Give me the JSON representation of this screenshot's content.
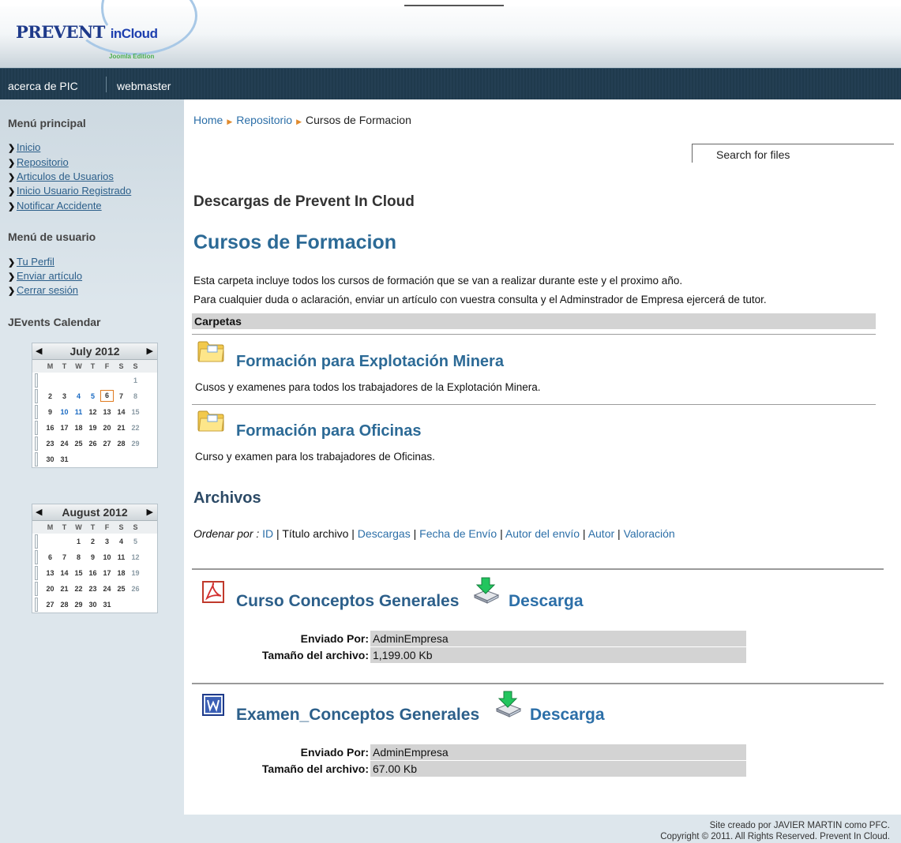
{
  "header": {
    "logo_main": "PREVENT",
    "logo_sub": "inCloud",
    "logo_edition": "Joomla Edition"
  },
  "nav": {
    "items": [
      {
        "label": "acerca de PIC"
      },
      {
        "label": "webmaster"
      }
    ]
  },
  "sidebar": {
    "main_menu_title": "Menú principal",
    "main_menu": [
      {
        "label": "Inicio"
      },
      {
        "label": "Repositorio"
      },
      {
        "label": "Articulos de Usuarios"
      },
      {
        "label": "Inicio Usuario Registrado"
      },
      {
        "label": "Notificar Accidente"
      }
    ],
    "user_menu_title": "Menú de usuario",
    "user_menu": [
      {
        "label": "Tu Perfil"
      },
      {
        "label": "Enviar artículo"
      },
      {
        "label": "Cerrar sesión"
      }
    ],
    "calendar_title": "JEvents Calendar",
    "calendar_prev": "◀",
    "calendar_next": "▶",
    "months": [
      {
        "title": "July 2012"
      },
      {
        "title": "August 2012"
      }
    ],
    "weekday_labels": [
      "M",
      "T",
      "W",
      "T",
      "F",
      "S",
      "S"
    ]
  },
  "main": {
    "breadcrumb": {
      "home": "Home",
      "repo": "Repositorio",
      "current": "Cursos de Formacion",
      "separator": "▶"
    },
    "search_placeholder": "Search for files",
    "downloads_title": "Descargas de Prevent In Cloud",
    "folder_title": "Cursos de Formacion",
    "description_1": "Esta carpeta incluye todos los cursos de formación que se van a realizar durante este y el proximo año.",
    "description_2": "Para cualquier duda o aclaración, enviar un artículo con vuestra consulta y el Adminstrador de Empresa ejercerá de tutor.",
    "folders_header": "Carpetas",
    "folders": [
      {
        "title": "Formación para Explotación Minera",
        "description": "Cusos y examenes para todos los trabajadores de la Explotación Minera."
      },
      {
        "title": "Formación para Oficinas",
        "description": "Curso y examen para los trabajadores de Oficinas."
      }
    ],
    "files_title": "Archivos",
    "sort": {
      "label": "Ordenar por :",
      "id": "ID",
      "sep": "|",
      "title": "Título archivo",
      "downloads": "Descargas",
      "date": "Fecha de Envío",
      "sender": "Autor del envío",
      "author": "Autor",
      "rating": "Valoración"
    },
    "files": [
      {
        "title": "Curso Conceptos Generales",
        "icon": "pdf-icon",
        "download_label": "Descarga",
        "sent_by_label": "Enviado Por:",
        "sent_by": "AdminEmpresa",
        "size_label": "Tamaño del archivo:",
        "size": "1,199.00 Kb"
      },
      {
        "title": "Examen_Conceptos Generales",
        "icon": "word-icon",
        "download_label": "Descarga",
        "sent_by_label": "Enviado Por:",
        "sent_by": "AdminEmpresa",
        "size_label": "Tamaño del archivo:",
        "size": "67.00 Kb"
      }
    ]
  },
  "footer": {
    "line1": "Site creado por JAVIER MARTIN como PFC.",
    "line2": "Copyright © 2011. All Rights Reserved. Prevent In Cloud."
  },
  "colors": {
    "navbar": "#1f3a4d",
    "sidebar": "#dde6ec",
    "link": "#2c6fa8",
    "heading": "#2c6a96",
    "accent_arrow": "#e08a2c"
  }
}
